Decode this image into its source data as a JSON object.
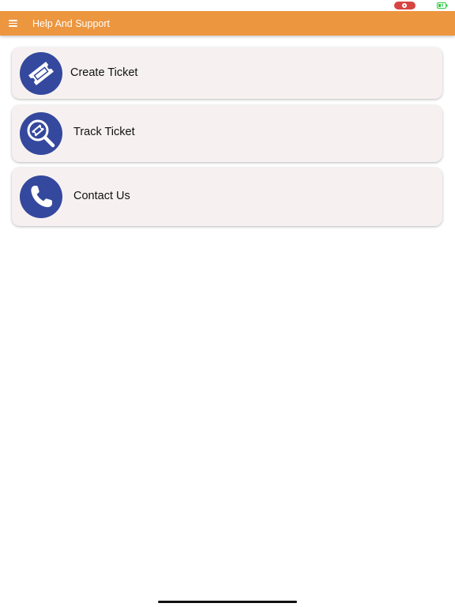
{
  "status_bar": {
    "record_icon": "screen-record-icon",
    "battery_icon": "battery-charging-icon",
    "record_color": "#d64541",
    "battery_color": "#2ecc40"
  },
  "header": {
    "title": "Help And Support",
    "menu_icon": "hamburger-menu-icon",
    "background": "#ec963f"
  },
  "menu": {
    "items": [
      {
        "label": "Create Ticket",
        "icon": "ticket-icon"
      },
      {
        "label": "Track Ticket",
        "icon": "search-ticket-icon"
      },
      {
        "label": "Contact Us",
        "icon": "phone-icon"
      }
    ],
    "icon_background": "#34489d",
    "card_background": "#f6f1f0"
  }
}
